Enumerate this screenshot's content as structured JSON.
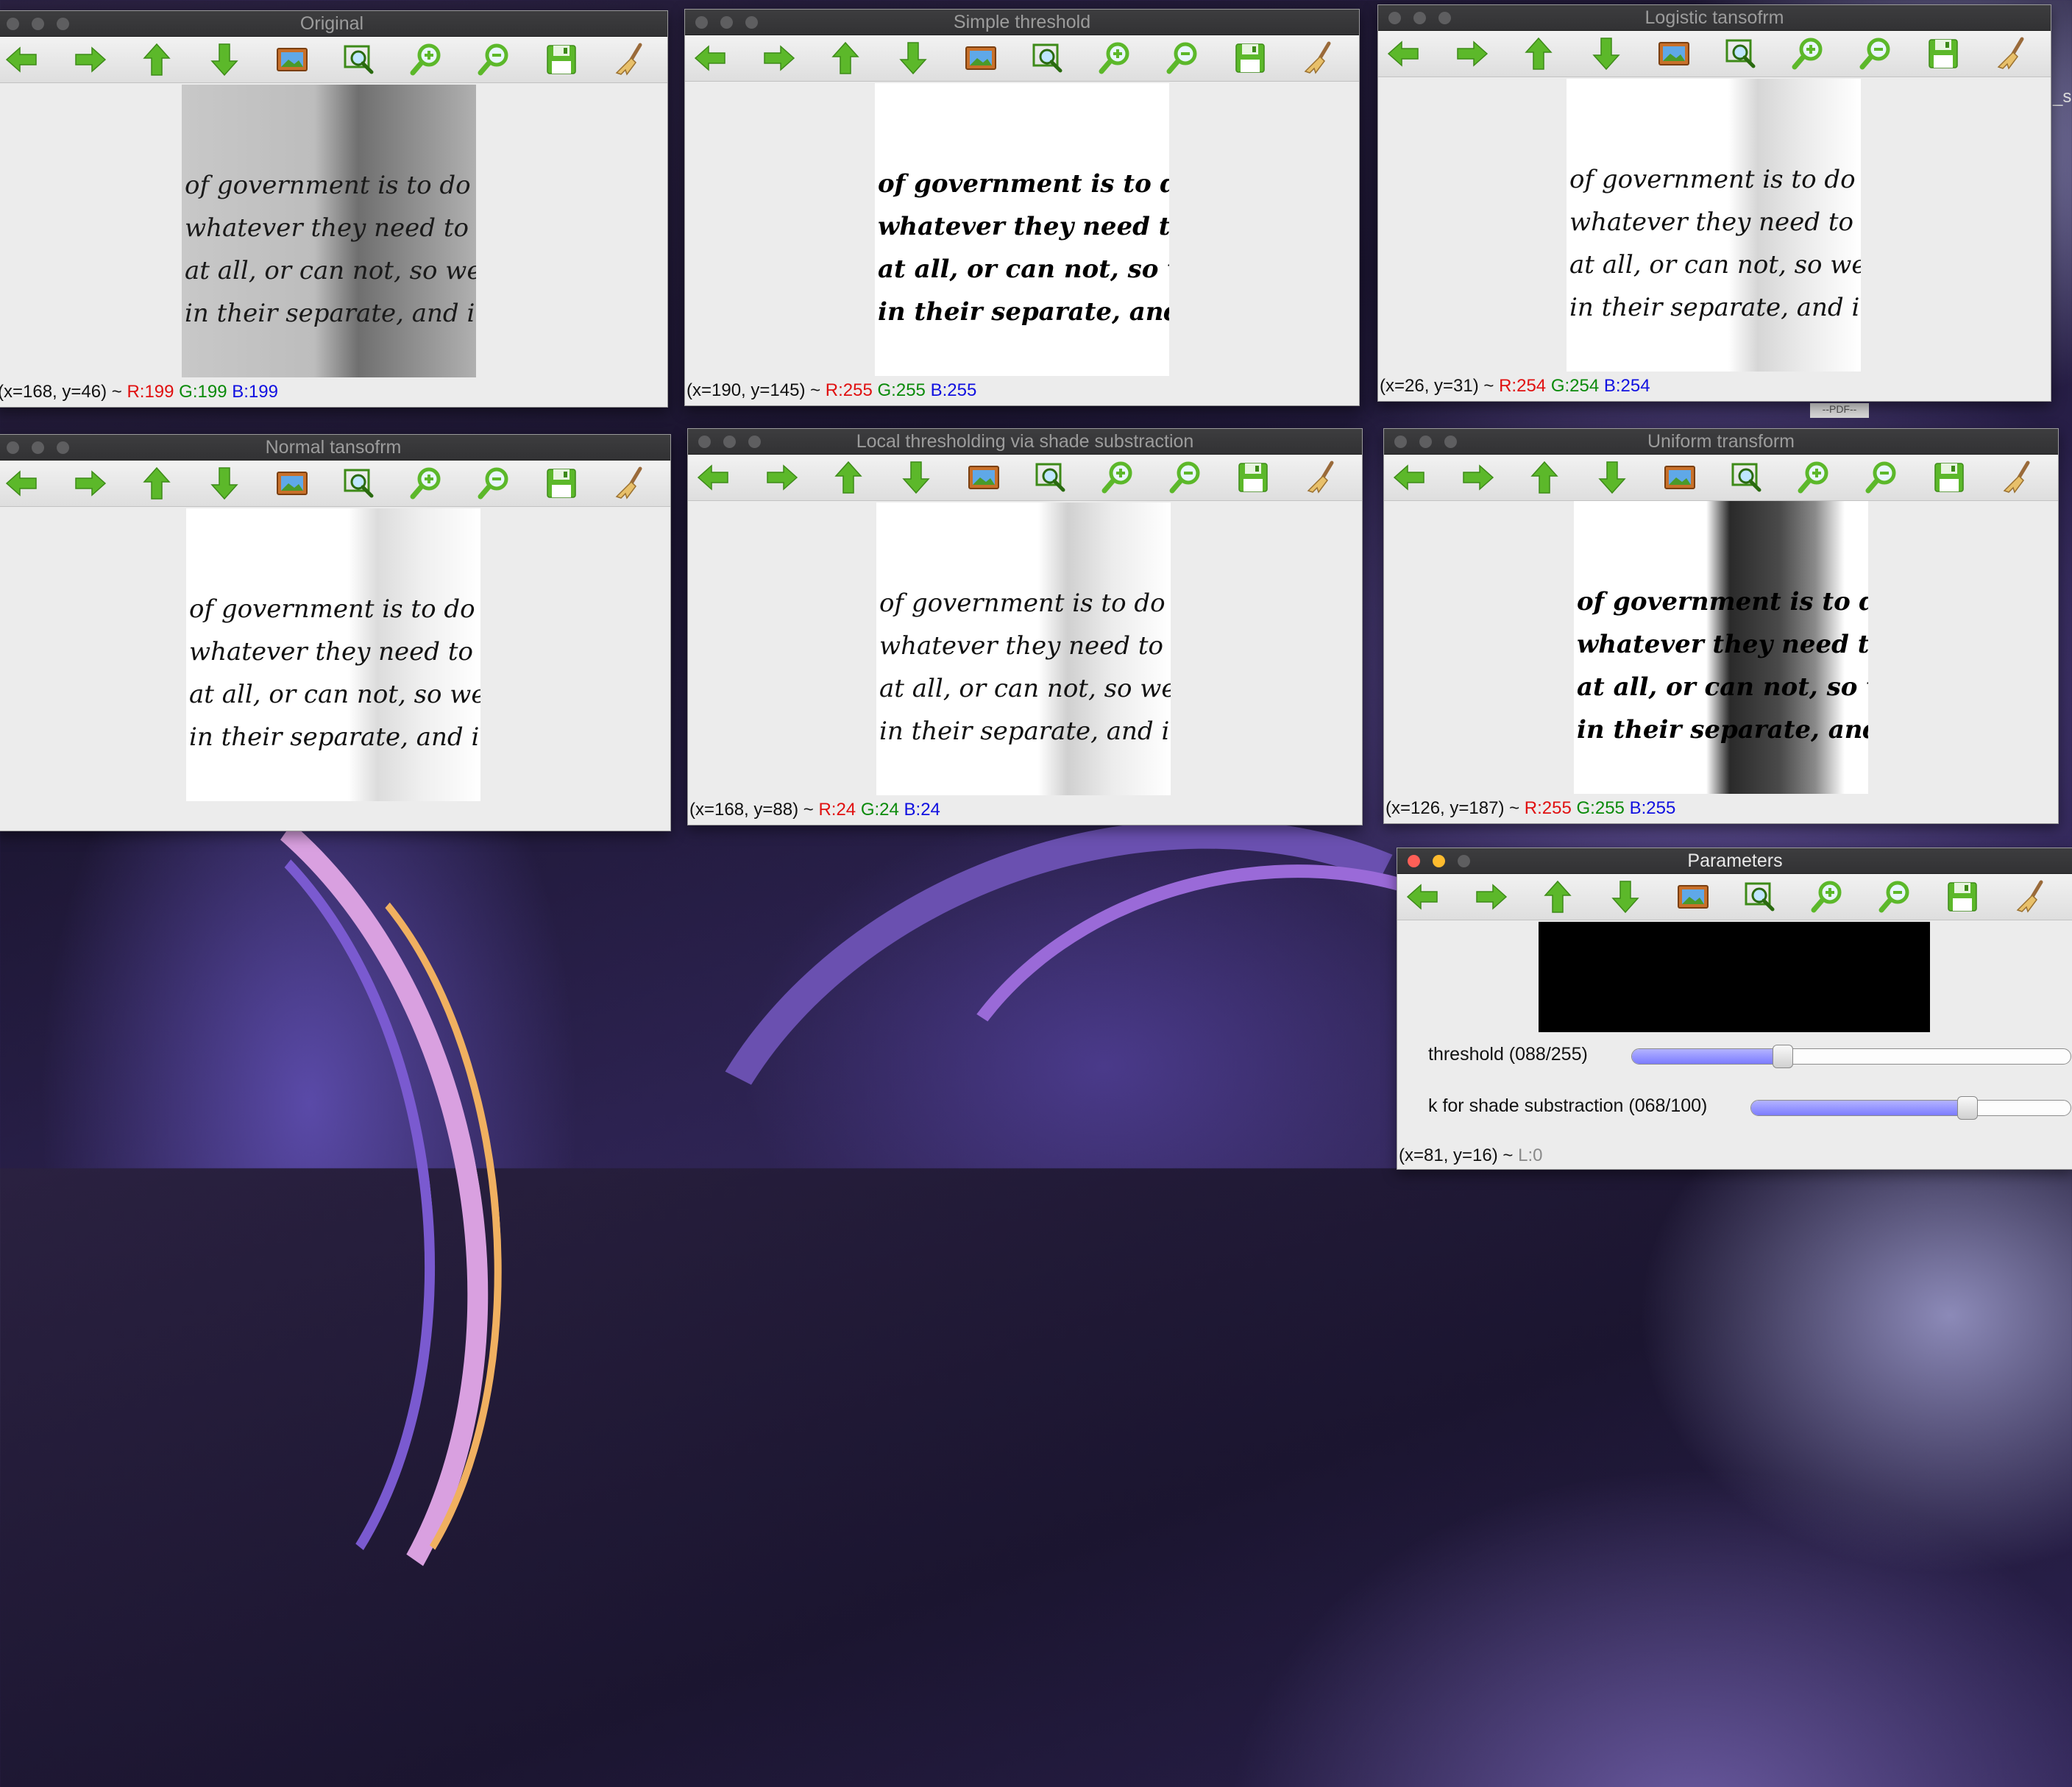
{
  "toolbar_icons": [
    "arrow-left-icon",
    "arrow-right-icon",
    "arrow-up-icon",
    "arrow-down-icon",
    "image-icon",
    "zoom-fit-icon",
    "zoom-in-icon",
    "zoom-out-icon",
    "save-icon",
    "brush-icon"
  ],
  "colors": {
    "green": "#5cb82a",
    "title_active": "#e8e8e8",
    "title_inactive": "#9c9c9c"
  },
  "windows": [
    {
      "title": "Original",
      "status": {
        "coords": "(x=168, y=46) ~ ",
        "r": "R:199",
        "g": "G:199",
        "b": "B:199"
      }
    },
    {
      "title": "Simple threshold",
      "status": {
        "coords": "(x=190, y=145) ~ ",
        "r": "R:255",
        "g": "G:255",
        "b": "B:255"
      }
    },
    {
      "title": "Logistic tansofrm",
      "status": {
        "coords": "(x=26, y=31) ~ ",
        "r": "R:254",
        "g": "G:254",
        "b": "B:254"
      }
    },
    {
      "title": "Normal tansofrm",
      "status": {
        "coords": "",
        "r": "",
        "g": "",
        "b": ""
      }
    },
    {
      "title": "Local thresholding via shade substraction",
      "status": {
        "coords": "(x=168, y=88) ~ ",
        "r": "R:24",
        "g": "G:24",
        "b": "B:24"
      }
    },
    {
      "title": "Uniform transform",
      "status": {
        "coords": "(x=126, y=187) ~ ",
        "r": "R:255",
        "g": "G:255",
        "b": "B:255"
      }
    }
  ],
  "handwriting": [
    "of government is to do for",
    "whatever they need to have",
    "at all, or can not, so well",
    "in their separate, and in"
  ],
  "parameters": {
    "title": "Parameters",
    "threshold_label": "threshold  (088/255)",
    "threshold_value": 88,
    "threshold_max": 255,
    "k_label": "k for shade substraction (068/100)",
    "k_value": 68,
    "k_max": 100,
    "status_coords": "(x=81, y=16) ~ ",
    "status_l": "L:0"
  },
  "desktop": {
    "pdf_label": "--PDF--",
    "edge_text": "_s"
  }
}
